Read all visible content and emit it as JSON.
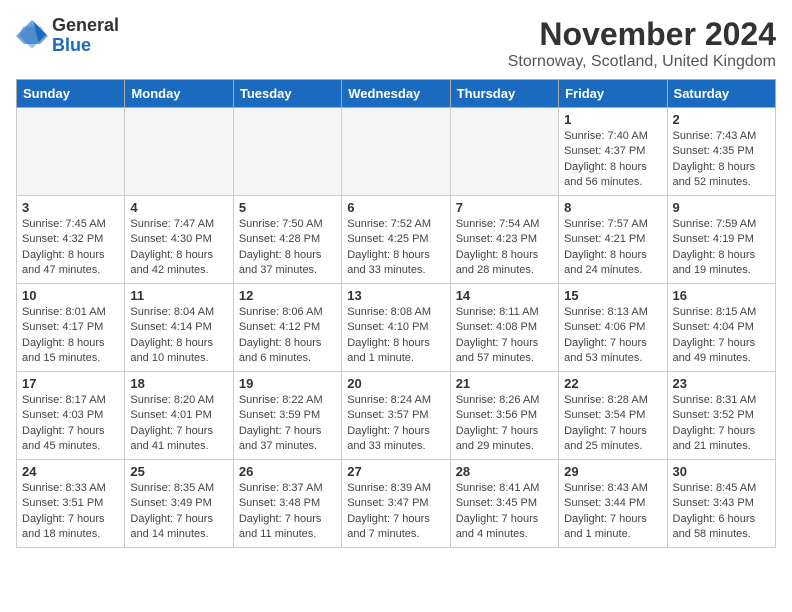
{
  "logo": {
    "general": "General",
    "blue": "Blue"
  },
  "title": {
    "month_year": "November 2024",
    "location": "Stornoway, Scotland, United Kingdom"
  },
  "headers": [
    "Sunday",
    "Monday",
    "Tuesday",
    "Wednesday",
    "Thursday",
    "Friday",
    "Saturday"
  ],
  "weeks": [
    [
      {
        "day": "",
        "info": ""
      },
      {
        "day": "",
        "info": ""
      },
      {
        "day": "",
        "info": ""
      },
      {
        "day": "",
        "info": ""
      },
      {
        "day": "",
        "info": ""
      },
      {
        "day": "1",
        "info": "Sunrise: 7:40 AM\nSunset: 4:37 PM\nDaylight: 8 hours\nand 56 minutes."
      },
      {
        "day": "2",
        "info": "Sunrise: 7:43 AM\nSunset: 4:35 PM\nDaylight: 8 hours\nand 52 minutes."
      }
    ],
    [
      {
        "day": "3",
        "info": "Sunrise: 7:45 AM\nSunset: 4:32 PM\nDaylight: 8 hours\nand 47 minutes."
      },
      {
        "day": "4",
        "info": "Sunrise: 7:47 AM\nSunset: 4:30 PM\nDaylight: 8 hours\nand 42 minutes."
      },
      {
        "day": "5",
        "info": "Sunrise: 7:50 AM\nSunset: 4:28 PM\nDaylight: 8 hours\nand 37 minutes."
      },
      {
        "day": "6",
        "info": "Sunrise: 7:52 AM\nSunset: 4:25 PM\nDaylight: 8 hours\nand 33 minutes."
      },
      {
        "day": "7",
        "info": "Sunrise: 7:54 AM\nSunset: 4:23 PM\nDaylight: 8 hours\nand 28 minutes."
      },
      {
        "day": "8",
        "info": "Sunrise: 7:57 AM\nSunset: 4:21 PM\nDaylight: 8 hours\nand 24 minutes."
      },
      {
        "day": "9",
        "info": "Sunrise: 7:59 AM\nSunset: 4:19 PM\nDaylight: 8 hours\nand 19 minutes."
      }
    ],
    [
      {
        "day": "10",
        "info": "Sunrise: 8:01 AM\nSunset: 4:17 PM\nDaylight: 8 hours\nand 15 minutes."
      },
      {
        "day": "11",
        "info": "Sunrise: 8:04 AM\nSunset: 4:14 PM\nDaylight: 8 hours\nand 10 minutes."
      },
      {
        "day": "12",
        "info": "Sunrise: 8:06 AM\nSunset: 4:12 PM\nDaylight: 8 hours\nand 6 minutes."
      },
      {
        "day": "13",
        "info": "Sunrise: 8:08 AM\nSunset: 4:10 PM\nDaylight: 8 hours\nand 1 minute."
      },
      {
        "day": "14",
        "info": "Sunrise: 8:11 AM\nSunset: 4:08 PM\nDaylight: 7 hours\nand 57 minutes."
      },
      {
        "day": "15",
        "info": "Sunrise: 8:13 AM\nSunset: 4:06 PM\nDaylight: 7 hours\nand 53 minutes."
      },
      {
        "day": "16",
        "info": "Sunrise: 8:15 AM\nSunset: 4:04 PM\nDaylight: 7 hours\nand 49 minutes."
      }
    ],
    [
      {
        "day": "17",
        "info": "Sunrise: 8:17 AM\nSunset: 4:03 PM\nDaylight: 7 hours\nand 45 minutes."
      },
      {
        "day": "18",
        "info": "Sunrise: 8:20 AM\nSunset: 4:01 PM\nDaylight: 7 hours\nand 41 minutes."
      },
      {
        "day": "19",
        "info": "Sunrise: 8:22 AM\nSunset: 3:59 PM\nDaylight: 7 hours\nand 37 minutes."
      },
      {
        "day": "20",
        "info": "Sunrise: 8:24 AM\nSunset: 3:57 PM\nDaylight: 7 hours\nand 33 minutes."
      },
      {
        "day": "21",
        "info": "Sunrise: 8:26 AM\nSunset: 3:56 PM\nDaylight: 7 hours\nand 29 minutes."
      },
      {
        "day": "22",
        "info": "Sunrise: 8:28 AM\nSunset: 3:54 PM\nDaylight: 7 hours\nand 25 minutes."
      },
      {
        "day": "23",
        "info": "Sunrise: 8:31 AM\nSunset: 3:52 PM\nDaylight: 7 hours\nand 21 minutes."
      }
    ],
    [
      {
        "day": "24",
        "info": "Sunrise: 8:33 AM\nSunset: 3:51 PM\nDaylight: 7 hours\nand 18 minutes."
      },
      {
        "day": "25",
        "info": "Sunrise: 8:35 AM\nSunset: 3:49 PM\nDaylight: 7 hours\nand 14 minutes."
      },
      {
        "day": "26",
        "info": "Sunrise: 8:37 AM\nSunset: 3:48 PM\nDaylight: 7 hours\nand 11 minutes."
      },
      {
        "day": "27",
        "info": "Sunrise: 8:39 AM\nSunset: 3:47 PM\nDaylight: 7 hours\nand 7 minutes."
      },
      {
        "day": "28",
        "info": "Sunrise: 8:41 AM\nSunset: 3:45 PM\nDaylight: 7 hours\nand 4 minutes."
      },
      {
        "day": "29",
        "info": "Sunrise: 8:43 AM\nSunset: 3:44 PM\nDaylight: 7 hours\nand 1 minute."
      },
      {
        "day": "30",
        "info": "Sunrise: 8:45 AM\nSunset: 3:43 PM\nDaylight: 6 hours\nand 58 minutes."
      }
    ]
  ]
}
